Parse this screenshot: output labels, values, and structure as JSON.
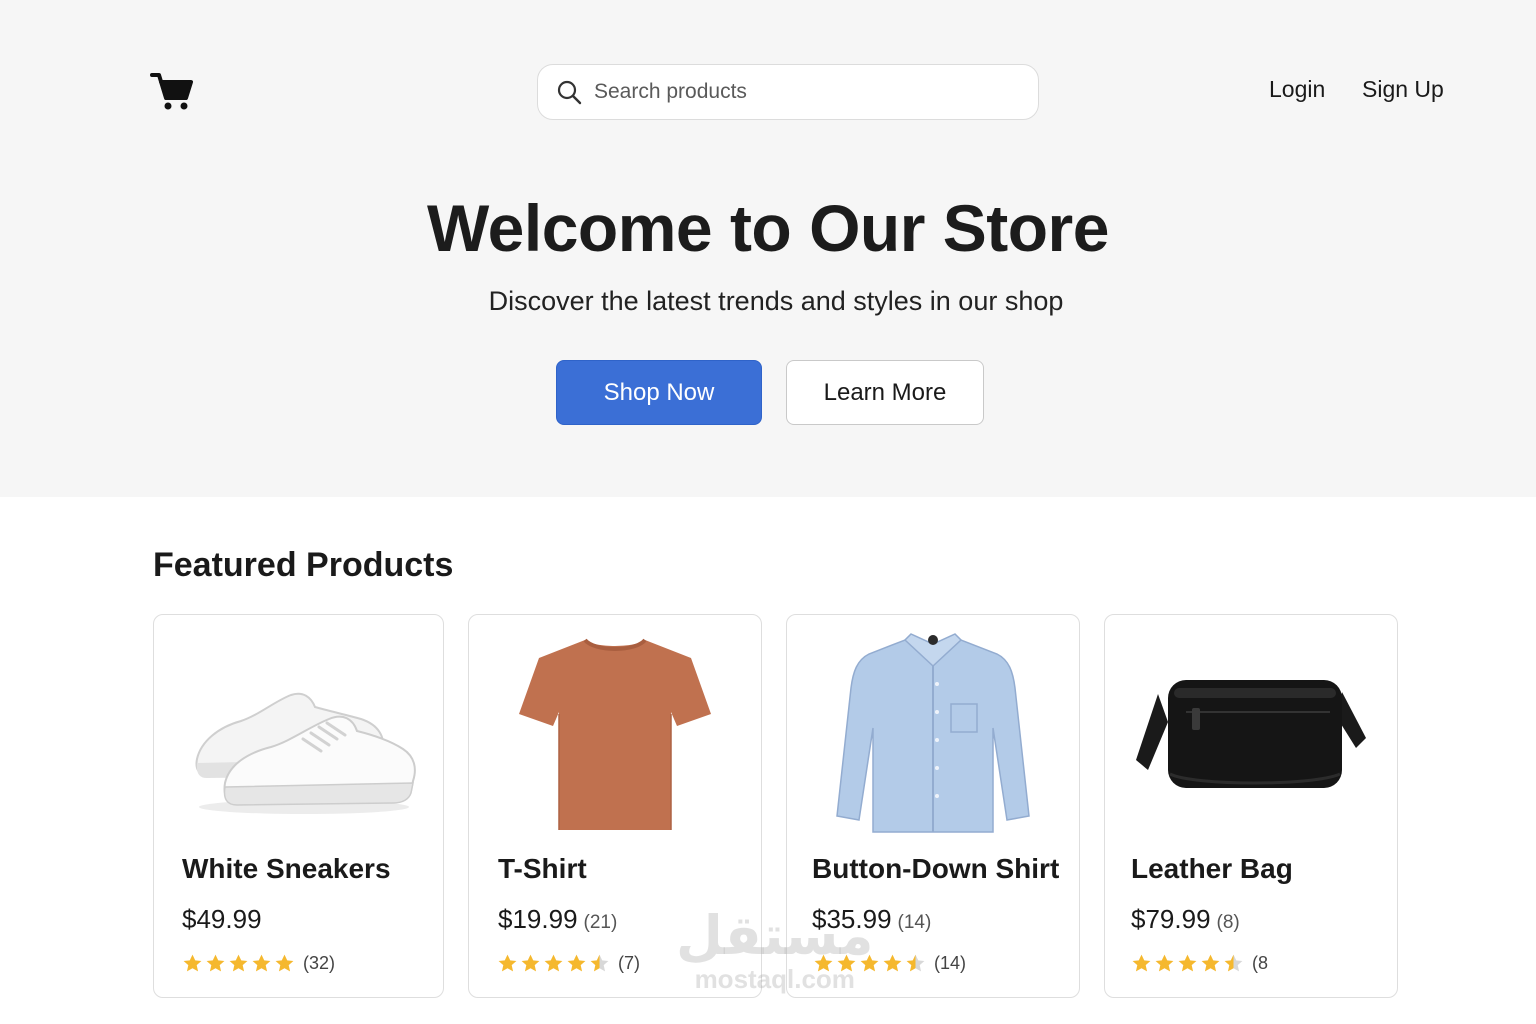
{
  "header": {
    "logo_icon": "shopping-cart-icon",
    "search": {
      "placeholder": "Search products",
      "value": "",
      "icon": "search-icon"
    },
    "nav": {
      "login": "Login",
      "signup": "Sign Up"
    }
  },
  "hero": {
    "title": "Welcome to Our Store",
    "subtitle": "Discover the latest trends and styles in our shop",
    "primary_button": "Shop Now",
    "secondary_button": "Learn More"
  },
  "featured": {
    "title": "Featured Products",
    "products": [
      {
        "name": "White Sneakers",
        "price": "$49.99",
        "price_count": "",
        "rating": 5,
        "rating_count": "(32)",
        "image": "white-sneakers-image"
      },
      {
        "name": "T-Shirt",
        "price": "$19.99",
        "price_count": "(21)",
        "rating": 4.5,
        "rating_count": "(7)",
        "image": "orange-tshirt-image"
      },
      {
        "name": "Button-Down Shirt",
        "price": "$35.99",
        "price_count": "(14)",
        "rating": 4.5,
        "rating_count": "(14)",
        "image": "blue-button-down-shirt-image"
      },
      {
        "name": "Leather Bag",
        "price": "$79.99",
        "price_count": "(8)",
        "rating": 4.5,
        "rating_count": "(8",
        "image": "black-leather-bag-image"
      }
    ]
  },
  "watermark": {
    "arabic": "مستقل",
    "latin": "mostaql.com"
  },
  "colors": {
    "primary": "#3b6fd6",
    "star": "#f5b82e",
    "hero_bg": "#f6f6f6"
  }
}
